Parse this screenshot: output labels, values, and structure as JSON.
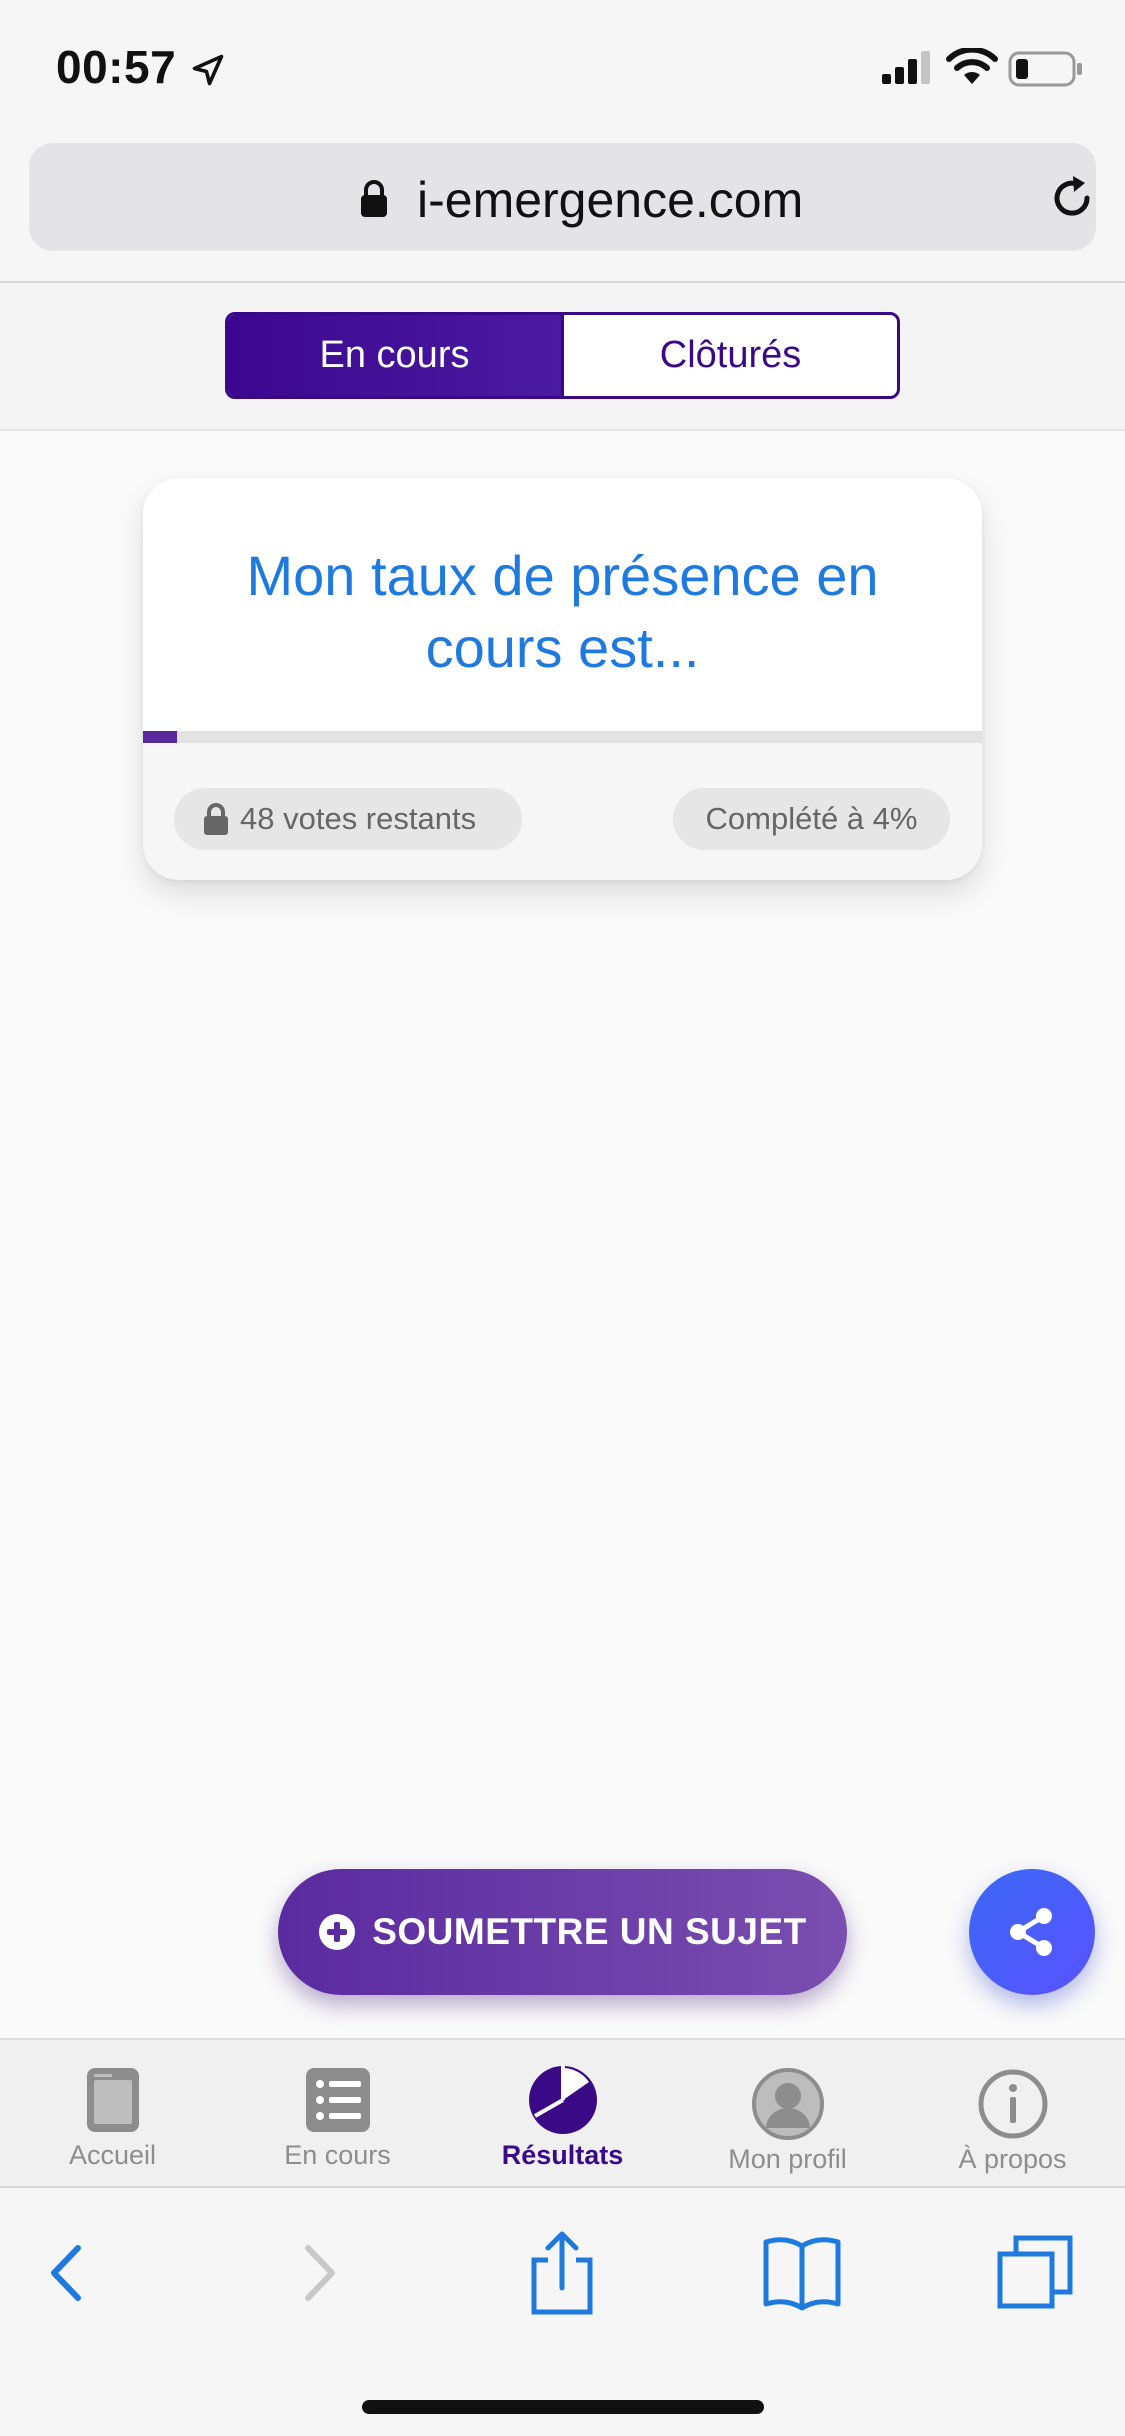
{
  "status_bar": {
    "time": "00:57",
    "icons": [
      "location-arrow-icon",
      "signal-icon",
      "wifi-icon",
      "battery-icon"
    ]
  },
  "browser": {
    "url": "i-emergence.com",
    "lock_icon": "lock-icon",
    "reload_icon": "reload-icon"
  },
  "segments": {
    "active": "En cours",
    "inactive": "Clôturés"
  },
  "card": {
    "title": "Mon taux de présence en cours est...",
    "progress_percent": 4,
    "votes_remaining": "48 votes restants",
    "completion": "Complété à 4%"
  },
  "actions": {
    "submit_label": "SOUMETTRE UN SUJET",
    "share_icon": "share-icon"
  },
  "tab_bar": {
    "items": [
      {
        "label": "Accueil",
        "icon": "home-tablet-icon",
        "active": false
      },
      {
        "label": "En cours",
        "icon": "list-icon",
        "active": false
      },
      {
        "label": "Résultats",
        "icon": "pie-chart-icon",
        "active": true
      },
      {
        "label": "Mon profil",
        "icon": "user-icon",
        "active": false
      },
      {
        "label": "À propos",
        "icon": "info-icon",
        "active": false
      }
    ]
  },
  "safari_toolbar": {
    "icons": [
      "back-icon",
      "forward-icon",
      "share-upload-icon",
      "bookmarks-icon",
      "tabs-icon"
    ]
  },
  "colors": {
    "accent_purple": "#3a0a86",
    "title_blue": "#1f7ae0",
    "share_blue": "#4a5cf8"
  }
}
